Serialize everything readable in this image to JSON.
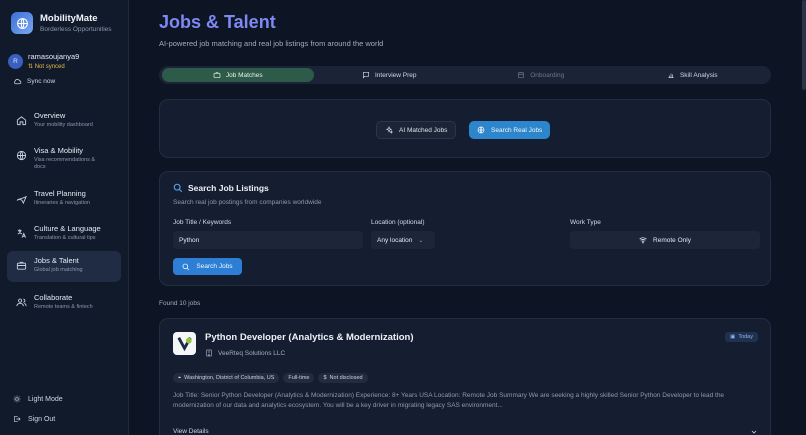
{
  "brand": {
    "name": "MobilityMate",
    "tagline": "Borderless Opportunities"
  },
  "user": {
    "initial": "R",
    "name": "ramasoujanya9",
    "sync_status": "Not synced",
    "sync_action": "Sync now"
  },
  "nav": [
    {
      "label": "Overview",
      "sub": "Your mobility dashboard",
      "icon": "home-icon"
    },
    {
      "label": "Visa & Mobility",
      "sub": "Visa recommendations & docs",
      "icon": "globe-icon"
    },
    {
      "label": "Travel Planning",
      "sub": "Itineraries & navigation",
      "icon": "plane-icon"
    },
    {
      "label": "Culture & Language",
      "sub": "Translation & cultural tips",
      "icon": "translate-icon"
    },
    {
      "label": "Jobs & Talent",
      "sub": "Global job matching",
      "icon": "briefcase-icon",
      "active": true
    },
    {
      "label": "Collaborate",
      "sub": "Remote teams & fintech",
      "icon": "users-icon"
    }
  ],
  "footer": {
    "theme": "Light Mode",
    "signout": "Sign Out"
  },
  "page": {
    "title": "Jobs & Talent",
    "subtitle": "AI-powered job matching and real job listings from around the world"
  },
  "tabs": [
    {
      "label": "Job Matches",
      "icon": "briefcase-icon",
      "active": true
    },
    {
      "label": "Interview Prep",
      "icon": "chat-icon"
    },
    {
      "label": "Onboarding",
      "icon": "calendar-icon",
      "disabled": true
    },
    {
      "label": "Skill Analysis",
      "icon": "chart-icon"
    }
  ],
  "mode": {
    "ai_label": "AI Matched Jobs",
    "real_label": "Search Real Jobs",
    "selected": "Search Real Jobs"
  },
  "search": {
    "title": "Search Job Listings",
    "subtitle": "Search real job postings from companies worldwide",
    "keywords_label": "Job Title / Keywords",
    "keywords_value": "Python",
    "location_label": "Location (optional)",
    "location_value": "Any location",
    "worktype_label": "Work Type",
    "worktype_value": "Remote Only",
    "button": "Search Jobs"
  },
  "results": {
    "count_text": "Found 10 jobs"
  },
  "job": {
    "title": "Python Developer (Analytics & Modernization)",
    "company": "VeeRteq Solutions LLC",
    "posted": "Today",
    "tags": [
      "Washington, District of Columbia, US",
      "Full-time",
      "Not disclosed"
    ],
    "description": "Job Title: Senior Python Developer (Analytics & Modernization) Experience: 8+ Years USA Location: Remote Job Summary We are seeking a highly skilled Senior Python Developer to lead the modernization of our data and analytics ecosystem. You will be a key driver in migrating legacy SAS environment...",
    "details_label": "View Details"
  },
  "colors": {
    "accent": "#7f89f2",
    "primary_button": "#2c7fd4",
    "active_tab": "#2e5a4a",
    "warning": "#e8b84a"
  }
}
